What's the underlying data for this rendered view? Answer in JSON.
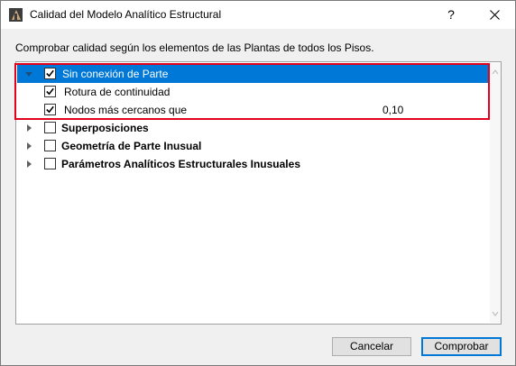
{
  "window": {
    "title": "Calidad del Modelo Analítico Estructural",
    "help_label": "?"
  },
  "instruction": "Comprobar calidad según los elementos de las Plantas de todos los Pisos.",
  "tree": {
    "items": [
      {
        "label": "Sin conexión de Parte",
        "checked": true,
        "expanded": true,
        "selected": true,
        "bold": false
      },
      {
        "label": "Rotura de continuidad",
        "checked": true
      },
      {
        "label": "Nodos más cercanos que",
        "checked": true,
        "value": "0,10"
      },
      {
        "label": "Superposiciones",
        "checked": false,
        "expanded": false,
        "bold": true
      },
      {
        "label": "Geometría de Parte Inusual",
        "checked": false,
        "expanded": false,
        "bold": true
      },
      {
        "label": "Parámetros Analíticos Estructurales Inusuales",
        "checked": false,
        "expanded": false,
        "bold": true
      }
    ]
  },
  "buttons": {
    "cancel": "Cancelar",
    "check": "Comprobar"
  },
  "colors": {
    "selection": "#0078d7",
    "highlight": "#e3001b"
  }
}
